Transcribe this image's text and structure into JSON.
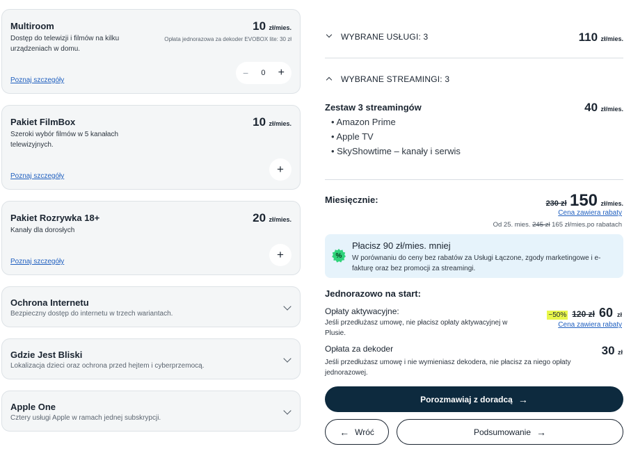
{
  "services": [
    {
      "title": "Multiroom",
      "description": "Dostęp do telewizji i filmów na kilku urządzeniach w domu.",
      "price": "10",
      "unit": "zł/mies.",
      "note": "Opłata jednorazowa za dekoder EVOBOX lite: 30 zł",
      "link": "Poznaj szczegóły",
      "quantity": "0",
      "minus_glyph": "−",
      "plus_glyph": "+"
    },
    {
      "title": "Pakiet FilmBox",
      "description": "Szeroki wybór filmów w 5 kanałach telewizyjnych.",
      "price": "10",
      "unit": "zł/mies.",
      "link": "Poznaj szczegóły",
      "plus_glyph": "+"
    },
    {
      "title": "Pakiet Rozrywka 18+",
      "description": "Kanały dla dorosłych",
      "price": "20",
      "unit": "zł/mies.",
      "link": "Poznaj szczegóły",
      "plus_glyph": "+"
    },
    {
      "title": "Ochrona Internetu",
      "description": "Bezpieczny dostęp do internetu w trzech wariantach."
    },
    {
      "title": "Gdzie Jest Bliski",
      "description": "Lokalizacja dzieci oraz ochrona przed hejtem i cyberprzemocą."
    },
    {
      "title": "Apple One",
      "description": "Cztery usługi Apple w ramach jednej subskrypcji."
    }
  ],
  "summary": {
    "selected_services": {
      "label": "WYBRANE USŁUGI: 3",
      "price": "110",
      "unit": "zł/mies."
    },
    "selected_streamings": {
      "label": "WYBRANE STREAMINGI: 3",
      "bundle_title": "Zestaw 3 streamingów",
      "price": "40",
      "unit": "zł/mies.",
      "items": [
        "• Amazon Prime",
        "• Apple TV",
        "• SkyShowtime – kanały i serwis"
      ]
    },
    "monthly": {
      "label": "Miesięcznie:",
      "old_price": "230 zł",
      "price": "150",
      "unit": "zł/mies.",
      "discount_link": "Cena zawiera rabaty",
      "from_prefix": "Od 25. mies.",
      "from_old": "245 zł",
      "from_suffix": "165 zł/mies.po rabatach"
    },
    "info": {
      "badge": "%",
      "title": "Płacisz 90 zł/mies. mniej",
      "text": "W porównaniu do ceny bez rabatów za Usługi Łączone, zgody marketingowe i e-fakturę oraz bez promocji za streamingi."
    },
    "one_time": {
      "label": "Jednorazowo na start:",
      "activation": {
        "title": "Opłaty aktywacyjne:",
        "text": "Jeśli przedłużasz umowę, nie płacisz opłaty aktywacyjnej w Plusie.",
        "discount": "−50%",
        "old_price": "120 zł",
        "price": "60",
        "unit": "zł",
        "link": "Cena zawiera rabaty"
      },
      "decoder": {
        "title": "Opłata za dekoder",
        "text": "Jeśli przedłużasz umowę i nie wymieniasz dekodera, nie płacisz za niego opłaty jednorazowej.",
        "price": "30",
        "unit": "zł"
      }
    },
    "buttons": {
      "consult": "Porozmawiaj z doradcą",
      "back": "Wróć",
      "summary": "Podsumowanie",
      "arrow_right": "→",
      "arrow_left": "←"
    }
  }
}
